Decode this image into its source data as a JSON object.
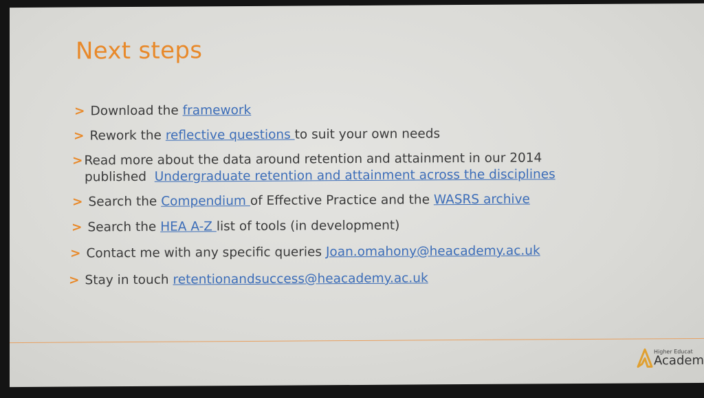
{
  "title": "Next steps",
  "bullet_icon": "chevron-right-icon",
  "items": [
    {
      "pre": "Download the ",
      "link": "framework",
      "post": ""
    },
    {
      "pre": "Rework the ",
      "link": "reflective questions ",
      "post": "to suit your own needs"
    },
    {
      "line1": "Read more about the data around retention and attainment in our 2014",
      "pre": "published  ",
      "link": "Undergraduate retention and attainment across the disciplines",
      "post": ""
    },
    {
      "pre": "Search the ",
      "link": "Compendium ",
      "mid": "of Effective Practice and the ",
      "link2": "WASRS archive"
    },
    {
      "pre": "Search the ",
      "link": "HEA A-Z ",
      "post": "list of tools (in development)"
    },
    {
      "pre": "Contact me with any specific queries ",
      "link": "Joan.omahony@heacademy.ac.uk",
      "post": ""
    },
    {
      "pre": "Stay in touch ",
      "link": "retentionandsuccess@heacademy.ac.uk",
      "post": ""
    }
  ],
  "logo": {
    "line1": "Higher Educat",
    "line2": "Academ"
  },
  "colors": {
    "accent": "#e8892a",
    "link": "#3c6db8",
    "text": "#3a3a3a"
  }
}
